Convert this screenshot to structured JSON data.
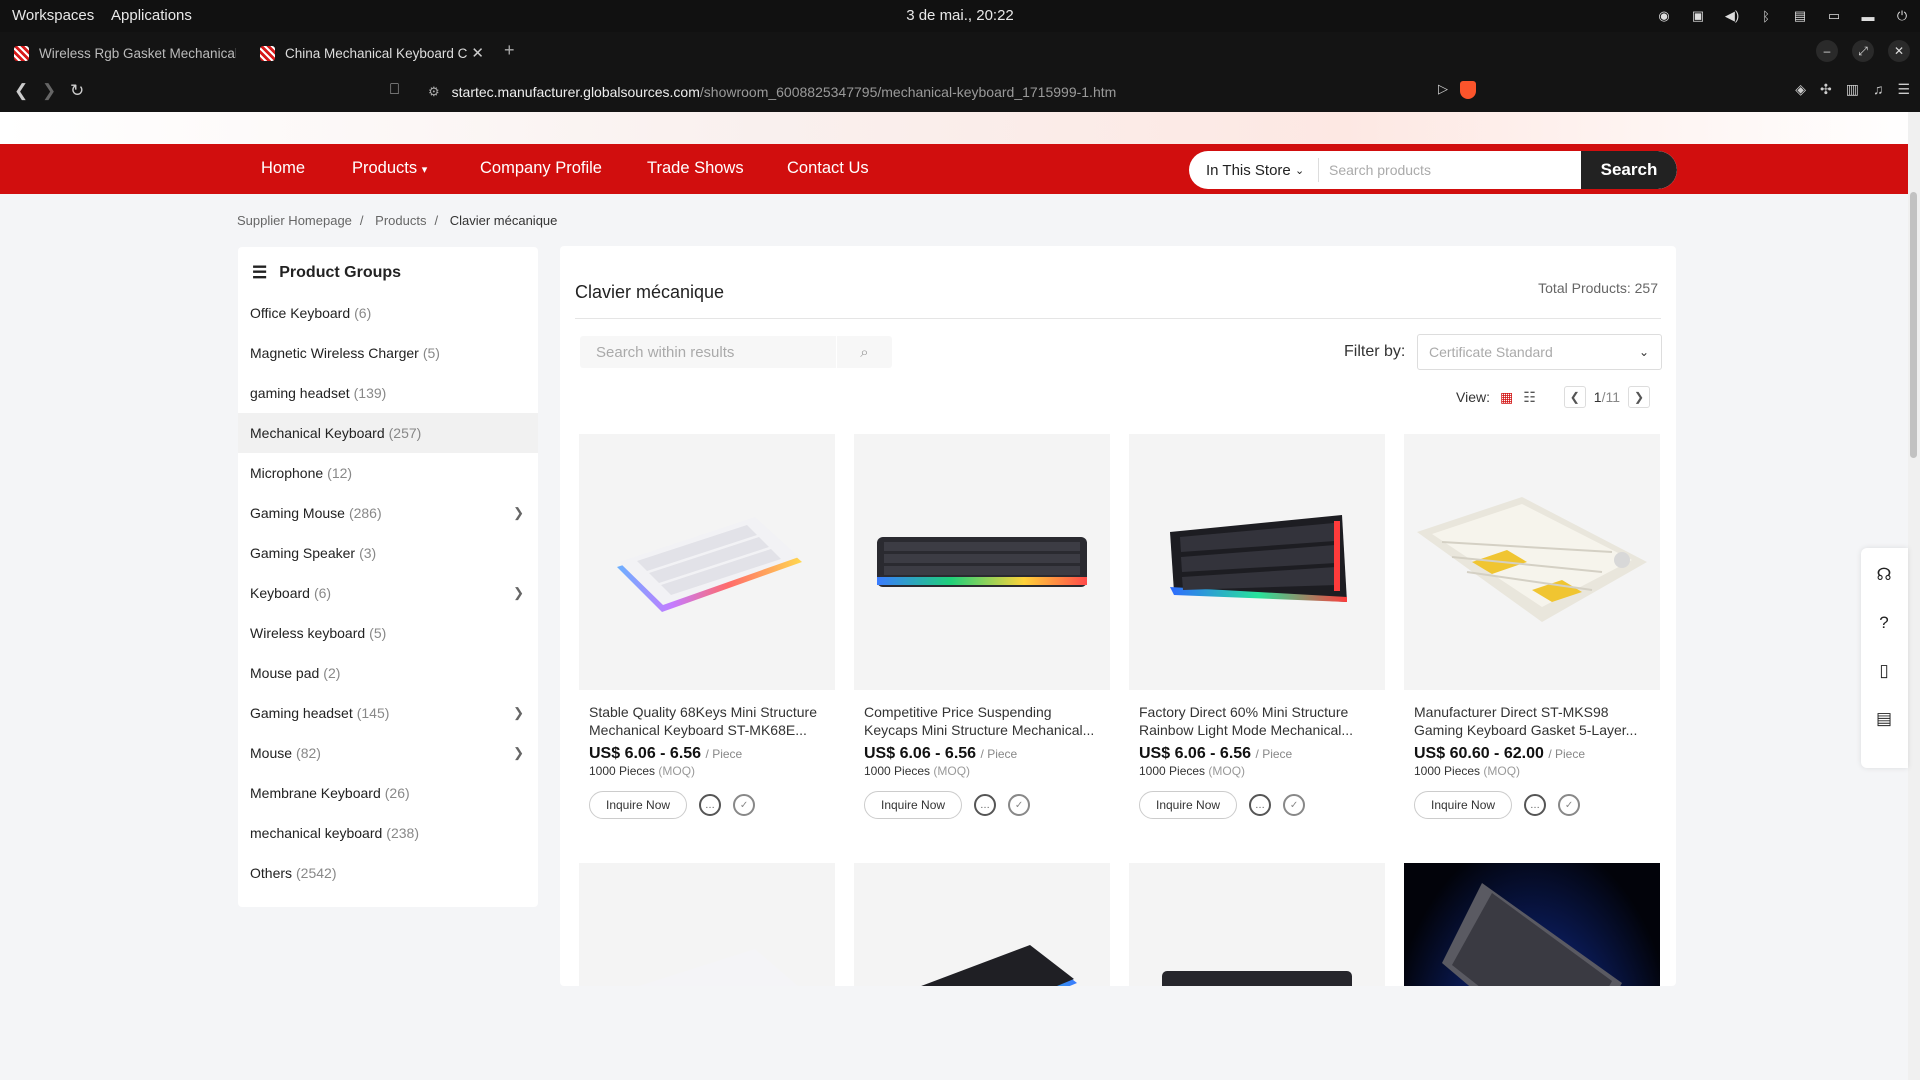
{
  "system": {
    "workspaces": "Workspaces",
    "applications": "Applications",
    "clock": "3 de mai., 20:22"
  },
  "tabs": [
    {
      "title": "Wireless Rgb Gasket Mechanical K"
    },
    {
      "title": "China Mechanical Keyboard C"
    }
  ],
  "address": {
    "domain": "startec.manufacturer.globalsources.com",
    "path": "/showroom_6008825347795/mechanical-keyboard_1715999-1.htm"
  },
  "nav": {
    "home": "Home",
    "products": "Products",
    "company_profile": "Company Profile",
    "trade_shows": "Trade Shows",
    "contact_us": "Contact Us",
    "scope": "In This Store",
    "search_placeholder": "Search products",
    "search_button": "Search"
  },
  "breadcrumb": {
    "home": "Supplier Homepage",
    "products": "Products",
    "current": "Clavier mécanique"
  },
  "sidebar": {
    "title": "Product Groups",
    "items": [
      {
        "label": "Office Keyboard",
        "count": "(6)"
      },
      {
        "label": "Magnetic Wireless Charger",
        "count": "(5)"
      },
      {
        "label": "gaming headset",
        "count": "(139)"
      },
      {
        "label": "Mechanical Keyboard",
        "count": "(257)"
      },
      {
        "label": "Microphone",
        "count": "(12)"
      },
      {
        "label": "Gaming Mouse",
        "count": "(286)"
      },
      {
        "label": "Gaming Speaker",
        "count": "(3)"
      },
      {
        "label": "Keyboard",
        "count": "(6)"
      },
      {
        "label": "Wireless keyboard",
        "count": "(5)"
      },
      {
        "label": "Mouse pad",
        "count": "(2)"
      },
      {
        "label": "Gaming headset",
        "count": "(145)"
      },
      {
        "label": "Mouse",
        "count": "(82)"
      },
      {
        "label": "Membrane Keyboard",
        "count": "(26)"
      },
      {
        "label": "mechanical keyboard",
        "count": "(238)"
      },
      {
        "label": "Others",
        "count": "(2542)"
      }
    ]
  },
  "content": {
    "title": "Clavier mécanique",
    "total": "Total Products: 257",
    "within_placeholder": "Search within results",
    "filter_label": "Filter by:",
    "filter_value": "Certificate Standard",
    "view_label": "View:",
    "page_current": "1",
    "page_total": "/11"
  },
  "products": [
    {
      "name": "Stable Quality 68Keys Mini Structure Mechanical Keyboard ST-MK68E...",
      "price": "US$ 6.06 - 6.56",
      "unit": "/ Piece",
      "moq": "1000 Pieces",
      "moq_label": "(MOQ)",
      "inquire": "Inquire Now"
    },
    {
      "name": "Competitive Price Suspending Keycaps Mini Structure Mechanical...",
      "price": "US$ 6.06 - 6.56",
      "unit": "/ Piece",
      "moq": "1000 Pieces",
      "moq_label": "(MOQ)",
      "inquire": "Inquire Now"
    },
    {
      "name": "Factory Direct 60% Mini Structure Rainbow Light Mode Mechanical...",
      "price": "US$ 6.06 - 6.56",
      "unit": "/ Piece",
      "moq": "1000 Pieces",
      "moq_label": "(MOQ)",
      "inquire": "Inquire Now"
    },
    {
      "name": "Manufacturer Direct ST-MKS98 Gaming Keyboard Gasket 5-Layer...",
      "price": "US$ 60.60 - 62.00",
      "unit": "/ Piece",
      "moq": "1000 Pieces",
      "moq_label": "(MOQ)",
      "inquire": "Inquire Now"
    }
  ],
  "colors": {
    "brand_red": "#d10e0e",
    "dark": "#111111"
  }
}
